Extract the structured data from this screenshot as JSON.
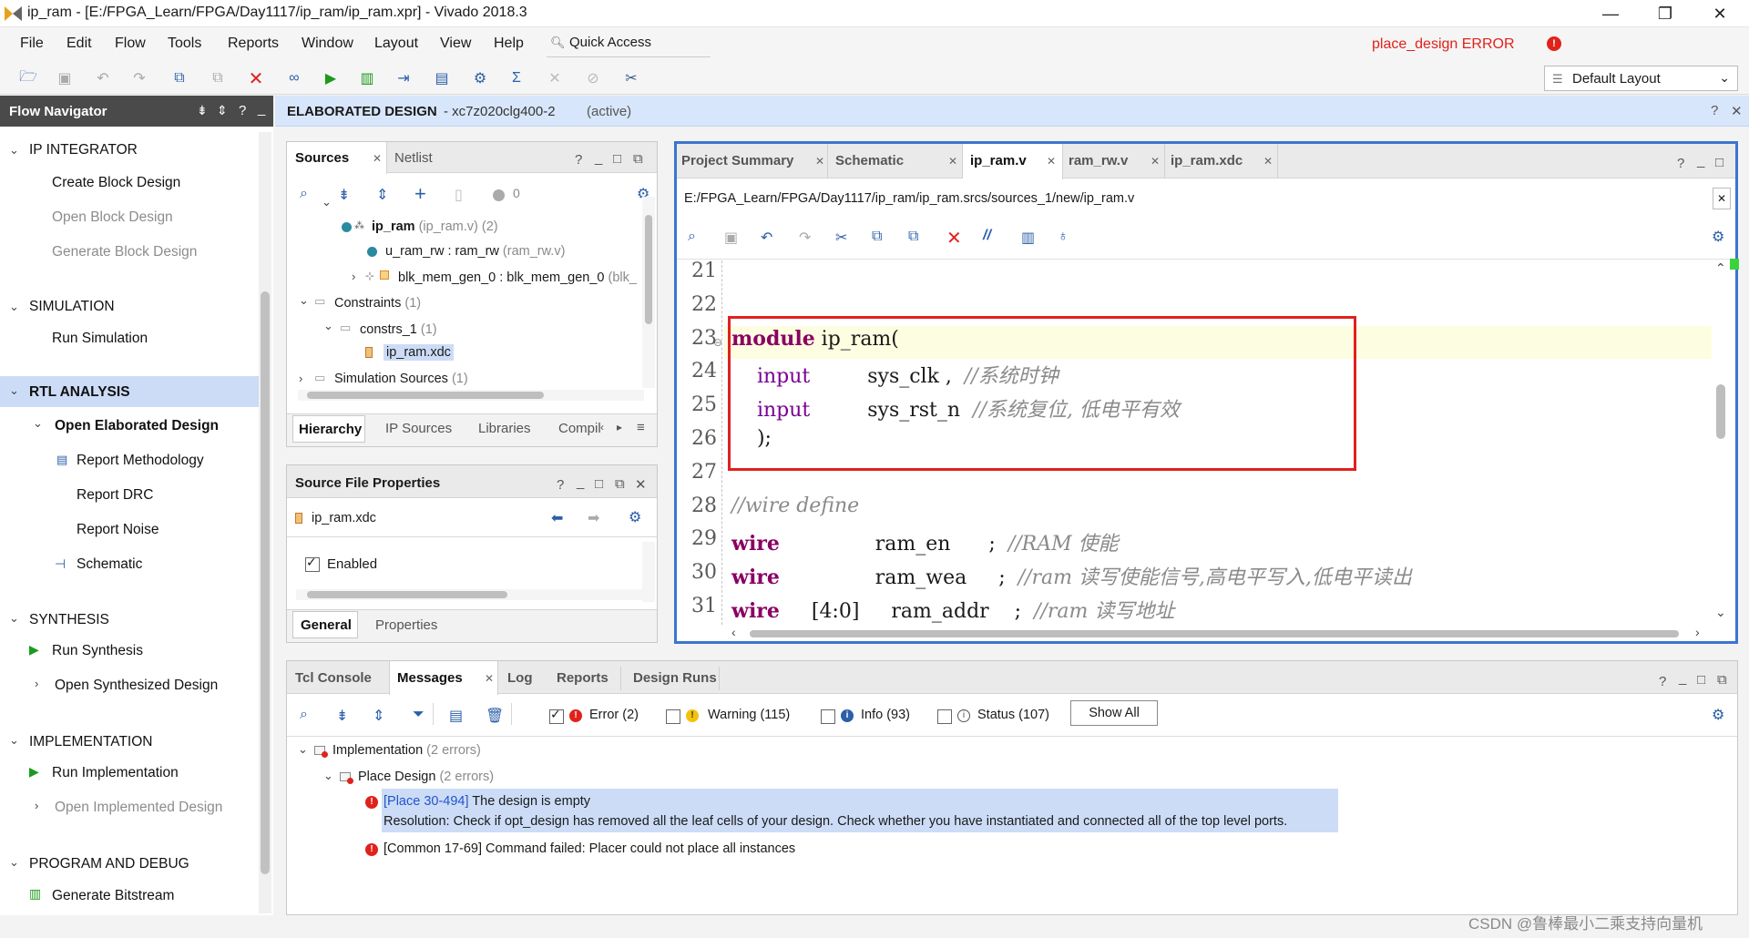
{
  "window": {
    "title": "ip_ram - [E:/FPGA_Learn/FPGA/Day1117/ip_ram/ip_ram.xpr] - Vivado 2018.3"
  },
  "menu": [
    "File",
    "Edit",
    "Flow",
    "Tools",
    "Reports",
    "Window",
    "Layout",
    "View",
    "Help"
  ],
  "quick_access": "Quick Access",
  "status_error": "place_design ERROR",
  "layout_select": "Default Layout",
  "flow_navigator": {
    "title": "Flow Navigator",
    "sections": [
      {
        "label": "IP INTEGRATOR",
        "items": [
          "Create Block Design",
          "Open Block Design",
          "Generate Block Design"
        ]
      },
      {
        "label": "SIMULATION",
        "items": [
          "Run Simulation"
        ]
      },
      {
        "label": "RTL ANALYSIS",
        "items": [
          "Open Elaborated Design",
          "Report Methodology",
          "Report DRC",
          "Report Noise",
          "Schematic"
        ]
      },
      {
        "label": "SYNTHESIS",
        "items": [
          "Run Synthesis",
          "Open Synthesized Design"
        ]
      },
      {
        "label": "IMPLEMENTATION",
        "items": [
          "Run Implementation",
          "Open Implemented Design"
        ]
      },
      {
        "label": "PROGRAM AND DEBUG",
        "items": [
          "Generate Bitstream"
        ]
      }
    ]
  },
  "banner": {
    "title": "ELABORATED DESIGN",
    "part": "- xc7z020clg400-2",
    "state": "(active)"
  },
  "sources": {
    "tabs": [
      "Sources",
      "Netlist"
    ],
    "zero": "0",
    "tree": [
      {
        "name": "ip_ram",
        "detail": "(ip_ram.v) (2)"
      },
      {
        "name": "u_ram_rw : ram_rw",
        "detail": "(ram_rw.v)"
      },
      {
        "name": "blk_mem_gen_0 : blk_mem_gen_0",
        "detail": "(blk_"
      },
      {
        "name": "Constraints",
        "detail": "(1)"
      },
      {
        "name": "constrs_1",
        "detail": "(1)"
      },
      {
        "name": "ip_ram.xdc",
        "detail": ""
      },
      {
        "name": "Simulation Sources",
        "detail": "(1)"
      }
    ],
    "bottom_tabs": [
      "Hierarchy",
      "IP Sources",
      "Libraries",
      "Compil"
    ]
  },
  "props": {
    "title": "Source File Properties",
    "file": "ip_ram.xdc",
    "enabled": "Enabled",
    "tabs": [
      "General",
      "Properties"
    ]
  },
  "editor": {
    "tabs": [
      "Project Summary",
      "Schematic",
      "ip_ram.v",
      "ram_rw.v",
      "ip_ram.xdc"
    ],
    "path": "E:/FPGA_Learn/FPGA/Day1117/ip_ram/ip_ram.srcs/sources_1/new/ip_ram.v",
    "lines": [
      {
        "n": "21",
        "code": ""
      },
      {
        "n": "22",
        "code": ""
      },
      {
        "n": "23",
        "kw": "module",
        "rest": " ip_ram("
      },
      {
        "n": "24",
        "kw": "    input",
        "rest": "         sys_clk ,  ",
        "cmt": "//系统时钟"
      },
      {
        "n": "25",
        "kw": "    input",
        "rest": "         sys_rst_n  ",
        "cmt": "//系统复位, 低电平有效"
      },
      {
        "n": "26",
        "rest": "    );"
      },
      {
        "n": "27",
        "code": ""
      },
      {
        "n": "28",
        "cmt": "//wire define"
      },
      {
        "n": "29",
        "kw": "wire",
        "rest": "               ram_en      ;  ",
        "cmt": "//RAM 使能"
      },
      {
        "n": "30",
        "kw": "wire",
        "rest": "               ram_wea     ;  ",
        "cmt": "//ram 读写使能信号,高电平写入,低电平读出"
      },
      {
        "n": "31",
        "kw": "wire",
        "rest": "     [4:0]     ram_addr    ;  ",
        "cmt": "//ram 读写地址"
      }
    ]
  },
  "messages": {
    "tabs": [
      "Tcl Console",
      "Messages",
      "Log",
      "Reports",
      "Design Runs"
    ],
    "filters": {
      "error": "Error (2)",
      "warning": "Warning (115)",
      "info": "Info (93)",
      "status": "Status (107)",
      "show_all": "Show All"
    },
    "tree": {
      "impl": "Implementation",
      "impl_n": "(2 errors)",
      "place": "Place Design",
      "place_n": "(2 errors)"
    },
    "m1_link": "[Place 30-494]",
    "m1_text": " The design is empty",
    "m1_res": "Resolution: Check if opt_design has removed all the leaf cells of your design. Check whether you have instantiated and connected all of the top level ports.",
    "m2": "[Common 17-69] Command failed: Placer could not place all instances"
  },
  "watermark": "CSDN @鲁棒最小二乘支持向量机",
  "colors": {
    "accent": "#3b75cf",
    "error": "#e0221b",
    "highlight": "#ccdcf7"
  }
}
